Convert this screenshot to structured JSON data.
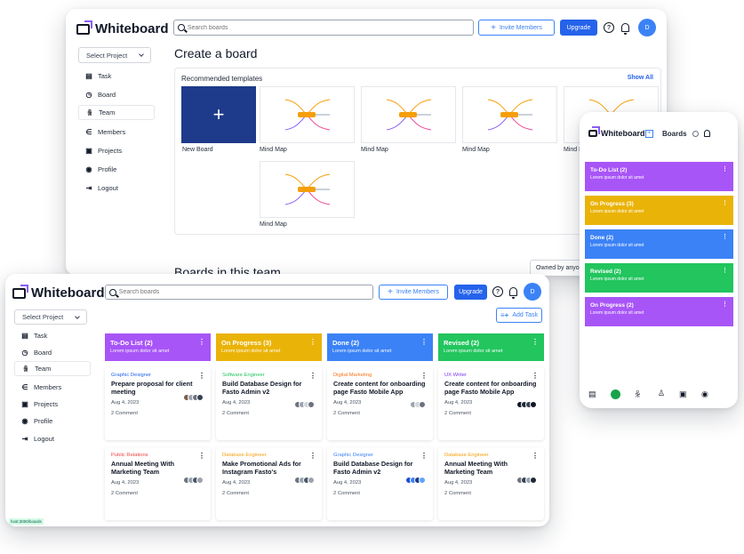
{
  "app": {
    "name": "Whiteboard"
  },
  "colors": {
    "primary": "#2563eb",
    "purple": "#a855f7",
    "yellow": "#eab308",
    "blue": "#3b82f6",
    "green": "#22c55e",
    "navy": "#1e3a8a"
  },
  "header": {
    "search_placeholder": "Search boards",
    "invite_label": "Invite Members",
    "upgrade_label": "Upgrade",
    "help_glyph": "?",
    "avatar_initial": "D"
  },
  "sidebar": {
    "select_project": "Select Project",
    "items": [
      {
        "label": "Task",
        "icon": "calendar-icon"
      },
      {
        "label": "Board",
        "icon": "clock-icon"
      },
      {
        "label": "Team",
        "icon": "team-icon"
      },
      {
        "label": "Members",
        "icon": "members-icon"
      },
      {
        "label": "Projects",
        "icon": "projects-icon"
      },
      {
        "label": "Profile",
        "icon": "profile-icon"
      },
      {
        "label": "Logout",
        "icon": "logout-icon"
      }
    ]
  },
  "boards_page": {
    "title": "Create a board",
    "recommended": "Recommended templates",
    "show_all": "Show All",
    "new_board": "New Board",
    "new_board_glyph": "+",
    "template_label": "Mind Map",
    "template_label_cut": "Mind M",
    "section_title": "Boards in this team",
    "owned_by": "Owned by anyone"
  },
  "kanban": {
    "add_task": "Add Task",
    "columns": [
      {
        "title": "To-Do List (2)",
        "subtitle": "Lorem ipsum dolor sit amet",
        "cards": [
          {
            "role": "Graphic Designer",
            "title": "Prepare proposal for client meeting",
            "date": "Aug 4, 2023",
            "comments": "2 Comment"
          },
          {
            "role": "Public Relations",
            "title": "Annual Meeting With Marketing Team",
            "date": "Aug 4, 2023",
            "comments": "2 Comment"
          }
        ]
      },
      {
        "title": "On Progress (3)",
        "subtitle": "Lorem ipsum dolor sit amet",
        "cards": [
          {
            "role": "Software Engineer",
            "title": "Build Database Design for Fasto Admin v2",
            "date": "Aug 4, 2023",
            "comments": "2 Comment"
          },
          {
            "role": "Database Engineer",
            "title": "Make Promotional Ads for Instagram Fasto's",
            "date": "Aug 4, 2023",
            "comments": "2 Comment"
          }
        ]
      },
      {
        "title": "Done (2)",
        "subtitle": "Lorem ipsum dolor sit amet",
        "cards": [
          {
            "role": "Digital Marketing",
            "title": "Create content for onboarding page Fasto Mobile App",
            "date": "Aug 4, 2023",
            "comments": "2 Comment"
          },
          {
            "role": "Graphic Designer",
            "title": "Build Database Design for Fasto Admin v2",
            "date": "Aug 4, 2023",
            "comments": "2 Comment"
          }
        ]
      },
      {
        "title": "Revised (2)",
        "subtitle": "Lorem ipsum dolor sit amet",
        "cards": [
          {
            "role": "UX Writer",
            "title": "Create content for onboarding page Fasto Mobile App",
            "date": "Aug 4, 2023",
            "comments": "2 Comment"
          },
          {
            "role": "Database Engineer",
            "title": "Annual Meeting With Marketing Team",
            "date": "Aug 4, 2023",
            "comments": "2 Comment"
          }
        ]
      }
    ],
    "url_tag": "host:3000/boards"
  },
  "mobile": {
    "title": "Boards",
    "lists": [
      {
        "title": "To-Do List (2)",
        "subtitle": "Lorem ipsum dolor sit amet"
      },
      {
        "title": "On Progress (3)",
        "subtitle": "Lorem ipsum dolor sit amet"
      },
      {
        "title": "Done (2)",
        "subtitle": "Lorem ipsum dolor sit amet"
      },
      {
        "title": "Revised (2)",
        "subtitle": "Lorem ipsum dolor sit amet"
      },
      {
        "title": "On Progress (2)",
        "subtitle": "Lorem ipsum dolor sit amet"
      }
    ]
  },
  "common": {
    "menu_dots": "⋮"
  }
}
